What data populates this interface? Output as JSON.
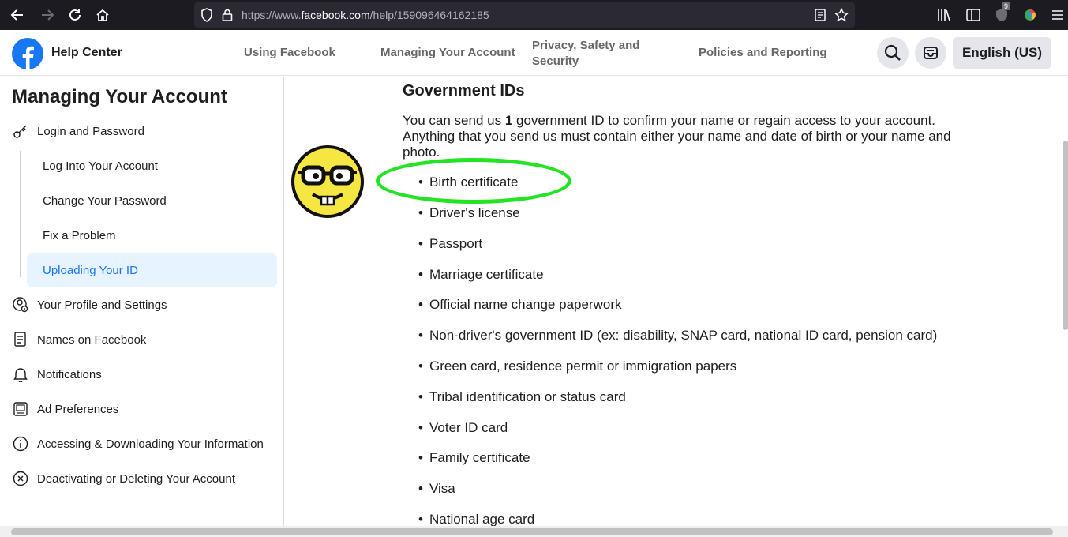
{
  "browser": {
    "url_prefix": "https://www.",
    "url_host": "facebook.com",
    "url_path": "/help/159096464162185",
    "extension_badge": "9"
  },
  "header": {
    "title": "Help Center",
    "nav": [
      "Using Facebook",
      "Managing Your Account",
      "Privacy, Safety and Security",
      "Policies and Reporting"
    ],
    "language": "English (US)"
  },
  "sidebar": {
    "title": "Managing Your Account",
    "items": [
      {
        "label": "Login and Password",
        "icon": "key-icon"
      },
      {
        "label": "Your Profile and Settings",
        "icon": "profile-gear-icon"
      },
      {
        "label": "Names on Facebook",
        "icon": "document-icon"
      },
      {
        "label": "Notifications",
        "icon": "bell-icon"
      },
      {
        "label": "Ad Preferences",
        "icon": "ad-icon"
      },
      {
        "label": "Accessing & Downloading Your Information",
        "icon": "info-icon"
      },
      {
        "label": "Deactivating or Deleting Your Account",
        "icon": "close-circle-icon"
      }
    ],
    "sub_items": [
      {
        "label": "Log Into Your Account"
      },
      {
        "label": "Change Your Password"
      },
      {
        "label": "Fix a Problem"
      },
      {
        "label": "Uploading Your ID",
        "active": true
      }
    ]
  },
  "content": {
    "title": "Government IDs",
    "intro_before": "You can send us ",
    "intro_bold": "1",
    "intro_after": " government ID to confirm your name or regain access to your account. Anything that you send us must contain either your name and date of birth or your name and photo.",
    "ids": [
      "Birth certificate",
      "Driver's license",
      "Passport",
      "Marriage certificate",
      "Official name change paperwork",
      "Non-driver's government ID (ex: disability, SNAP card, national ID card, pension card)",
      "Green card, residence permit or immigration papers",
      "Tribal identification or status card",
      "Voter ID card",
      "Family certificate",
      "Visa",
      "National age card"
    ]
  },
  "colors": {
    "brand": "#1877f2",
    "highlight": "#22e422",
    "emoji": "#f5e642"
  }
}
